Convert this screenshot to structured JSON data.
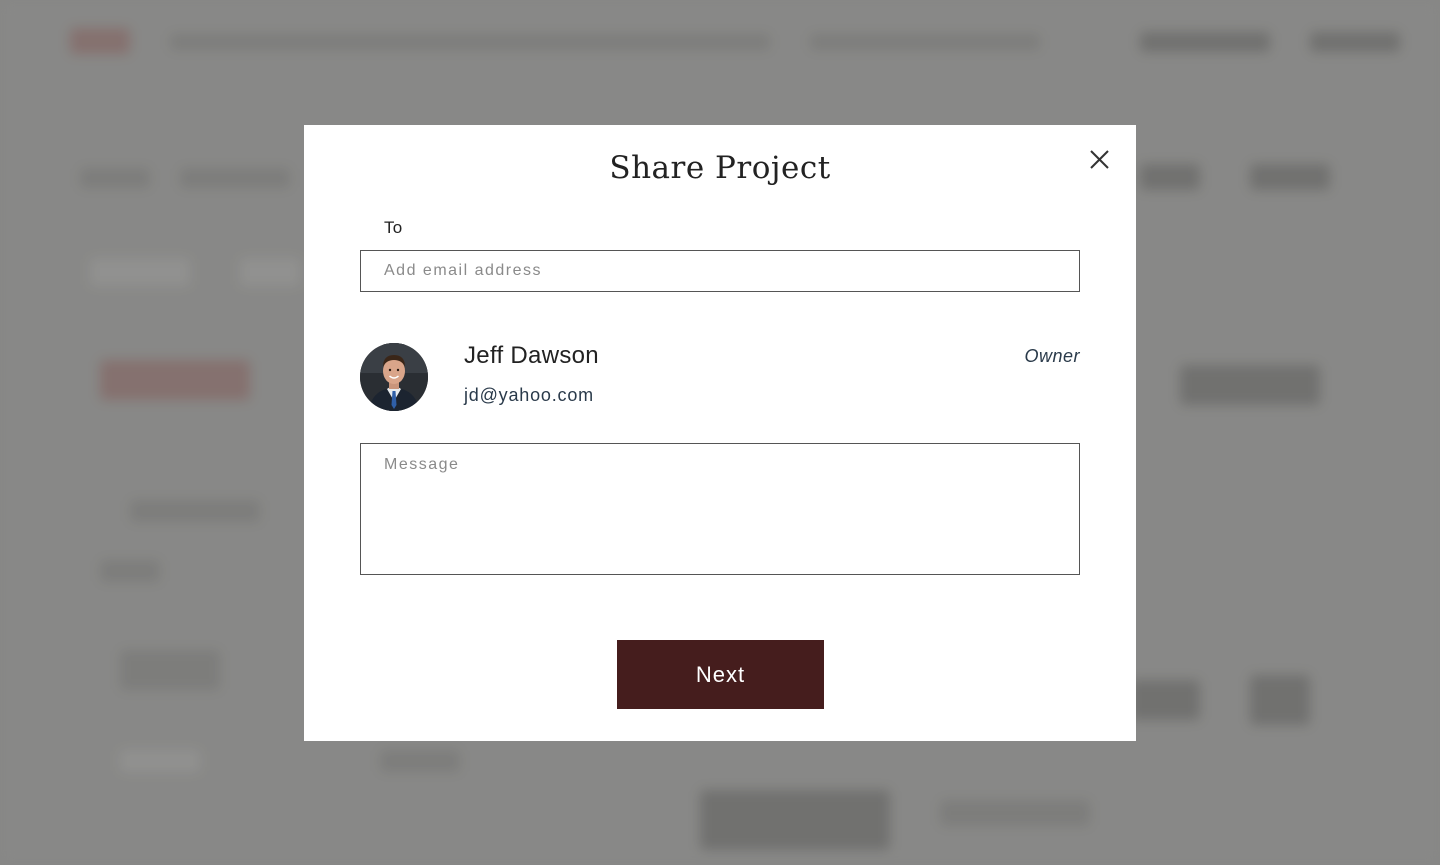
{
  "dialog": {
    "title": "Share Project",
    "to_label": "To",
    "email_placeholder": "Add email address",
    "message_placeholder": "Message",
    "next_label": "Next"
  },
  "collaborators": [
    {
      "name": "Jeff Dawson",
      "email": "jd@yahoo.com",
      "role": "Owner"
    }
  ],
  "colors": {
    "primary_button": "#451d1d",
    "overlay": "#8c8c8a",
    "text": "#222222"
  },
  "icons": {
    "close": "close-icon"
  }
}
